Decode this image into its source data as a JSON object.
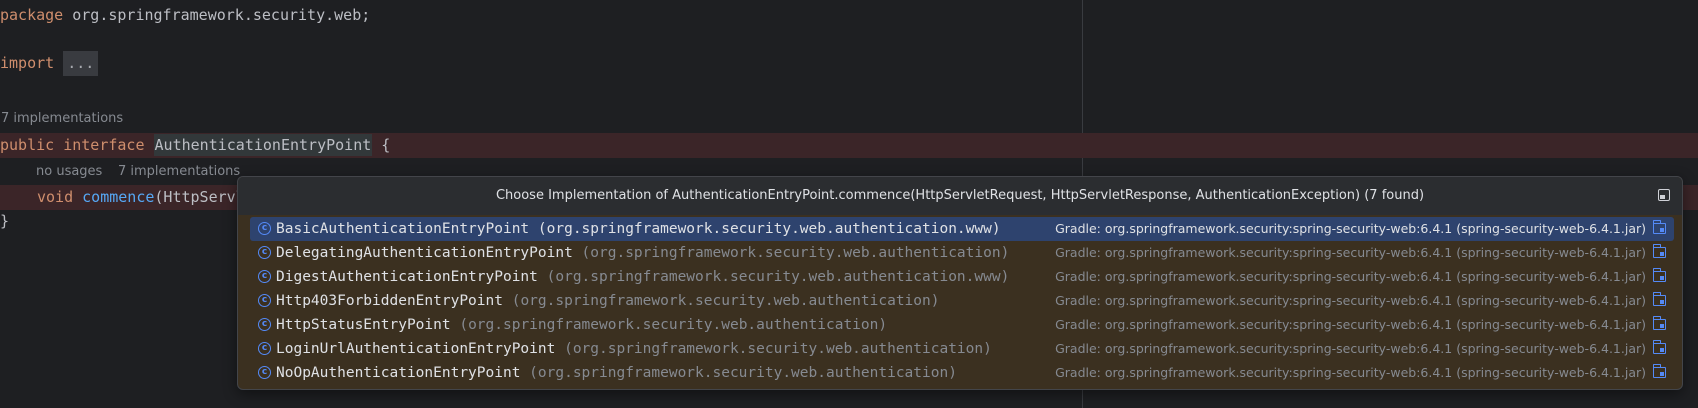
{
  "editor": {
    "line_package": {
      "kw": "package",
      "rest": " org.springframework.security.web;"
    },
    "line_import": {
      "kw": "import",
      "fold": "..."
    },
    "hint_implementations_top": "7 implementations",
    "line_interface": {
      "kw1": "public",
      "kw2": "interface",
      "name": "AuthenticationEntryPoint",
      "rest": " {"
    },
    "hint_usages": "no usages",
    "hint_implementations_method": "7 implementations",
    "line_method": {
      "kw": "void",
      "fn": "commence",
      "rest": "(HttpServl"
    },
    "line_close": "}"
  },
  "popup": {
    "title": "Choose Implementation of AuthenticationEntryPoint.commence(HttpServletRequest, HttpServletResponse, AuthenticationException) (7 found)",
    "items": [
      {
        "name": "BasicAuthenticationEntryPoint",
        "package": " (org.springframework.security.web.authentication.www)",
        "library": "Gradle: org.springframework.security:spring-security-web:6.4.1 (spring-security-web-6.4.1.jar)"
      },
      {
        "name": "DelegatingAuthenticationEntryPoint",
        "package": " (org.springframework.security.web.authentication)",
        "library": "Gradle: org.springframework.security:spring-security-web:6.4.1 (spring-security-web-6.4.1.jar)"
      },
      {
        "name": "DigestAuthenticationEntryPoint",
        "package": " (org.springframework.security.web.authentication.www)",
        "library": "Gradle: org.springframework.security:spring-security-web:6.4.1 (spring-security-web-6.4.1.jar)"
      },
      {
        "name": "Http403ForbiddenEntryPoint",
        "package": " (org.springframework.security.web.authentication)",
        "library": "Gradle: org.springframework.security:spring-security-web:6.4.1 (spring-security-web-6.4.1.jar)"
      },
      {
        "name": "HttpStatusEntryPoint",
        "package": " (org.springframework.security.web.authentication)",
        "library": "Gradle: org.springframework.security:spring-security-web:6.4.1 (spring-security-web-6.4.1.jar)"
      },
      {
        "name": "LoginUrlAuthenticationEntryPoint",
        "package": " (org.springframework.security.web.authentication)",
        "library": "Gradle: org.springframework.security:spring-security-web:6.4.1 (spring-security-web-6.4.1.jar)"
      },
      {
        "name": "NoOpAuthenticationEntryPoint",
        "package": " (org.springframework.security.web.authentication)",
        "library": "Gradle: org.springframework.security:spring-security-web:6.4.1 (spring-security-web-6.4.1.jar)"
      }
    ],
    "selected_index": 0,
    "class_icon": "class-icon",
    "library_icon": "jar-library-icon",
    "pin_icon": "pin-popup-icon"
  },
  "colors": {
    "background": "#1e1f22",
    "keyword": "#cf8e6d",
    "method": "#56a8f5",
    "selection": "#2e436e",
    "popup_background": "#3b3020",
    "highlight_line": "#3b2528"
  }
}
